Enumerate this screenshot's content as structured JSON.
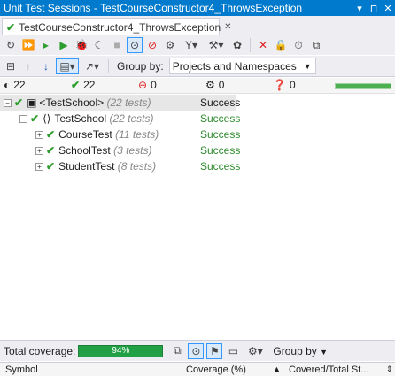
{
  "window": {
    "title": "Unit Test Sessions - TestCourseConstructor4_ThrowsException",
    "controls": [
      "▾",
      "⊓",
      "✕"
    ]
  },
  "tab": {
    "label": "TestCourseConstructor4_ThrowsException",
    "close": "✕"
  },
  "toolbar1": {
    "icons": [
      "refresh-icon",
      "run-all-icon",
      "run-selected-icon",
      "run-icon",
      "debug-icon",
      "cover-icon",
      "stop-icon",
      "track-running-test-icon",
      "stop-on-fail-icon",
      "settings-icon",
      "filter-icon",
      "build-icon",
      "profile-icon",
      "remove-icon",
      "lock-icon",
      "history-icon",
      "export-icon"
    ]
  },
  "toolbar2": {
    "group_by_label": "Group by:",
    "group_by_value": "Projects and Namespaces"
  },
  "stats": {
    "total": "22",
    "passed": "22",
    "failed": "0",
    "ignored": "0",
    "unknown": "0"
  },
  "tree": [
    {
      "label": "<TestSchool>",
      "count": "(22 tests)",
      "result": "Success"
    },
    {
      "label": "TestSchool",
      "count": "(22 tests)",
      "result": "Success"
    },
    {
      "label": "CourseTest",
      "count": "(11 tests)",
      "result": "Success"
    },
    {
      "label": "SchoolTest",
      "count": "(3 tests)",
      "result": "Success"
    },
    {
      "label": "StudentTest",
      "count": "(8 tests)",
      "result": "Success"
    }
  ],
  "coverage": {
    "label": "Total coverage:",
    "percent_text": "94%",
    "group_by_label": "Group by"
  },
  "columns": {
    "symbol": "Symbol",
    "coverage": "Coverage (%)",
    "covered_total": "Covered/Total St..."
  }
}
